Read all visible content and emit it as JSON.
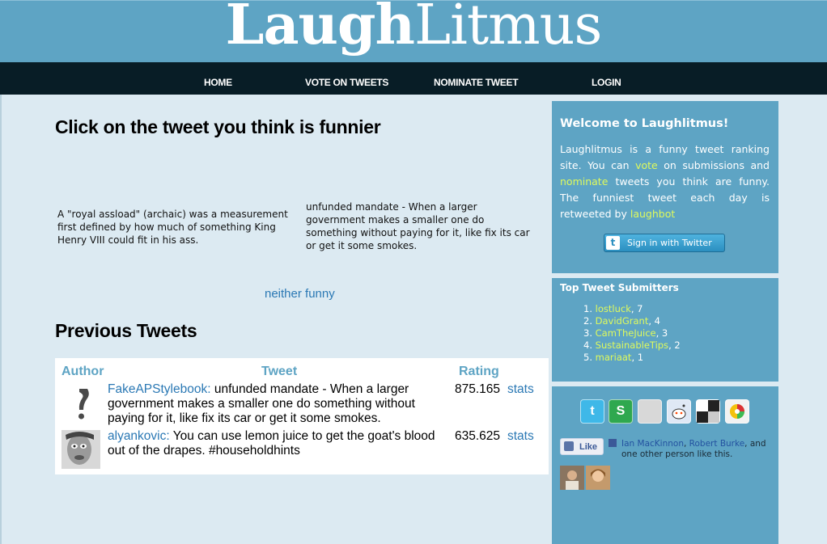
{
  "site": {
    "logo_bold": "Laugh",
    "logo_light": "Litmus"
  },
  "nav": {
    "home": "HOME",
    "vote": "VOTE ON TWEETS",
    "nominate": "NOMINATE TWEET",
    "login": "LOGIN"
  },
  "main": {
    "title": "Click on the tweet you think is funnier",
    "tweet_a": "A \"royal assload\" (archaic) was a measurement first defined by how much of something King Henry VIII could fit in his ass.",
    "tweet_b": "unfunded mandate - When a larger government makes a smaller one do something without paying for it, like fix its car or get it some smokes.",
    "neither": "neither funny"
  },
  "previous": {
    "title": "Previous Tweets",
    "headers": {
      "author": "Author",
      "tweet": "Tweet",
      "rating": "Rating"
    },
    "rows": [
      {
        "user": "FakeAPStylebook:",
        "text": " unfunded mandate - When a larger government makes a smaller one do something without paying for it, like fix its car or get it some smokes.",
        "rating": "875.165",
        "stats": "stats"
      },
      {
        "user": "alyankovic:",
        "text": " You can use lemon juice to get the goat's blood out of the drapes. #householdhints",
        "rating": "635.625",
        "stats": "stats"
      }
    ]
  },
  "sidebar": {
    "welcome_title": "Welcome to Laughlitmus!",
    "welcome": {
      "p1": "Laughlitmus is a funny tweet ranking site. You can ",
      "vote_link": "vote",
      "p2": " on submissions and ",
      "nominate_link": "nominate",
      "p3": " tweets you think are funny. The funniest tweet each day is retweeted by ",
      "bot_link": "laughbot"
    },
    "twitter_button": "Sign in with Twitter",
    "submitters_title": "Top Tweet Submitters",
    "submitters": [
      {
        "num": "1.",
        "name": "lostluck",
        "count": ", 7"
      },
      {
        "num": "2.",
        "name": "DavidGrant",
        "count": ", 4"
      },
      {
        "num": "3.",
        "name": "CamTheJuice",
        "count": ", 3"
      },
      {
        "num": "4.",
        "name": "SustainableTips",
        "count": ", 2"
      },
      {
        "num": "5.",
        "name": "mariaat",
        "count": ", 1"
      }
    ],
    "like_button": "Like",
    "like": {
      "name1": "Ian MacKinnon",
      "sep": ", ",
      "name2": "Robert Burke",
      "tail": ", and",
      "line2": "one other person like this."
    }
  },
  "colors": {
    "header_bg": "#5ea4c4",
    "nav_bg": "#081d26",
    "page_bg": "#dceaf2",
    "link": "#2a78b4",
    "sidebar_link": "#dffa5c"
  }
}
